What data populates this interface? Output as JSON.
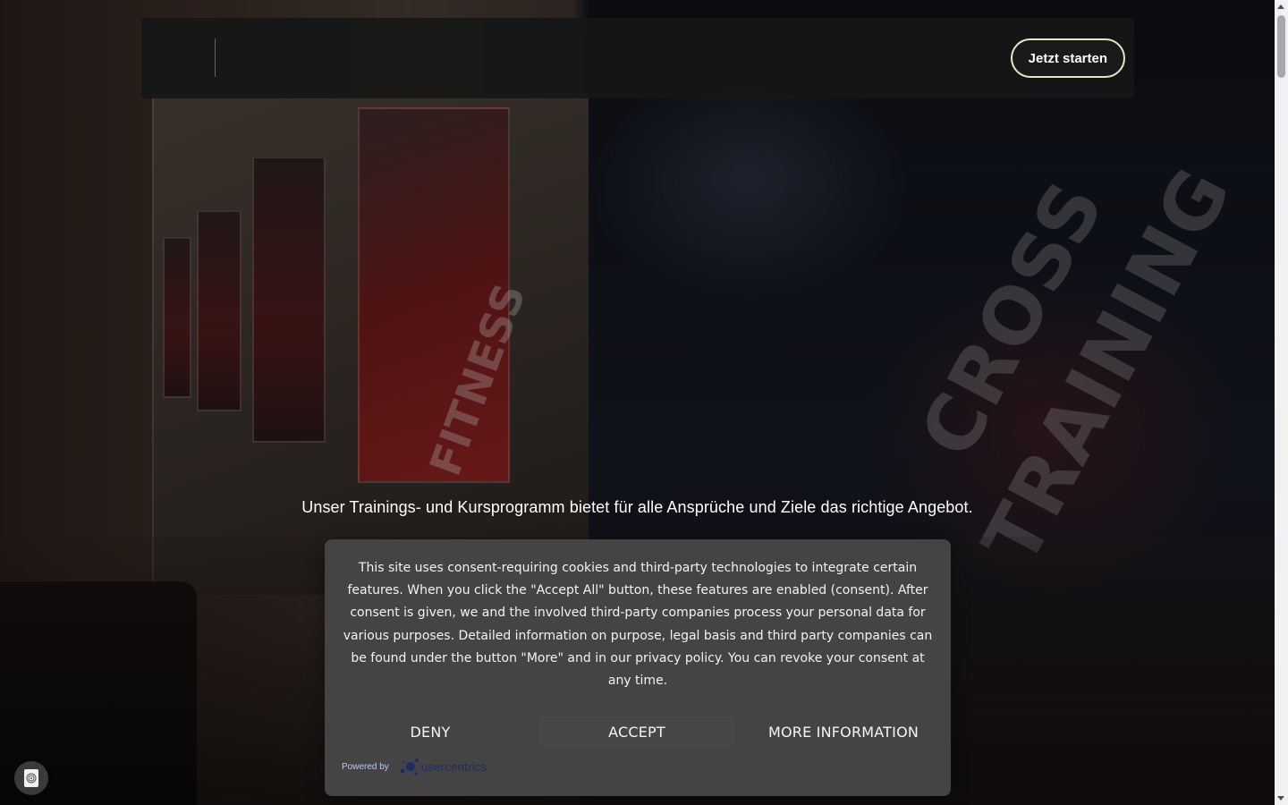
{
  "header": {
    "cta_label": "Jetzt starten"
  },
  "hero": {
    "tagline": "Unser Trainings- und Kursprogramm bietet für alle Ansprüche und Ziele das richtige Angebot.",
    "banner_text_line1": "CROSS",
    "banner_text_line2": "TRAINING",
    "poster_text": "FITNESS"
  },
  "consent": {
    "message": "This site uses consent-requiring cookies and third-party technologies to integrate certain features. When you click the \"Accept All\" button, these features are enabled (consent). After consent is given, we and the involved third-party companies process your personal data for various purposes. Detailed information on purpose, legal basis and third party companies can be found under the button \"More\" and in our privacy policy. You can revoke your consent at any time.",
    "deny_label": "DENY",
    "accept_label": "ACCEPT",
    "more_label": "MORE INFORMATION",
    "powered_by_label": "Powered by",
    "brand_name": "usercentrics"
  },
  "icons": {
    "privacy": "fingerprint-icon",
    "brand_logo": "usercentrics-logo-icon"
  },
  "colors": {
    "consent_bg": "#444444",
    "cta_border": "#e8e4c8",
    "brand_blue": "#1d2b68"
  }
}
